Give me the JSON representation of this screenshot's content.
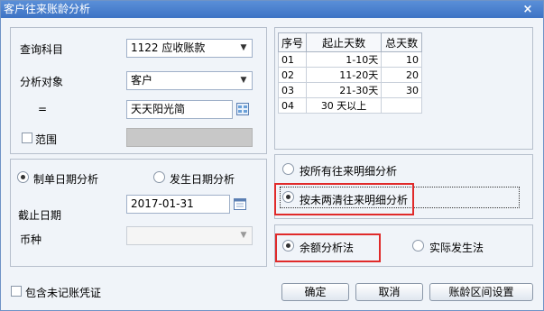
{
  "window": {
    "title": "客户往来账龄分析",
    "close_glyph": "×"
  },
  "left": {
    "subject_label": "查询科目",
    "subject_value": "1122 应收账款",
    "object_label": "分析对象",
    "object_value": "客户",
    "equals_label": "=",
    "equals_value": "天天阳光简",
    "range_label": "范围",
    "range_value": ""
  },
  "date_mode": {
    "option1": "制单日期分析",
    "option2": "发生日期分析",
    "cutoff_label": "截止日期",
    "cutoff_value": "2017-01-31",
    "currency_label": "币种",
    "currency_value": ""
  },
  "aging_table": {
    "headers": [
      "序号",
      "起止天数",
      "总天数"
    ],
    "rows": [
      {
        "no": "01",
        "range": "1-10天",
        "total": "10"
      },
      {
        "no": "02",
        "range": "11-20天",
        "total": "20"
      },
      {
        "no": "03",
        "range": "21-30天",
        "total": "30"
      },
      {
        "no": "04",
        "range": "30 天以上",
        "total": ""
      }
    ]
  },
  "detail_mode": {
    "option1": "按所有往来明细分析",
    "option2": "按未两清往来明细分析"
  },
  "method": {
    "option1": "余额分析法",
    "option2": "实际发生法"
  },
  "footer": {
    "include_label": "包含未记账凭证",
    "ok": "确定",
    "cancel": "取消",
    "settings": "账龄区间设置"
  },
  "colors": {
    "titlebar": "#3d73c4",
    "highlight": "#e02a2a"
  }
}
